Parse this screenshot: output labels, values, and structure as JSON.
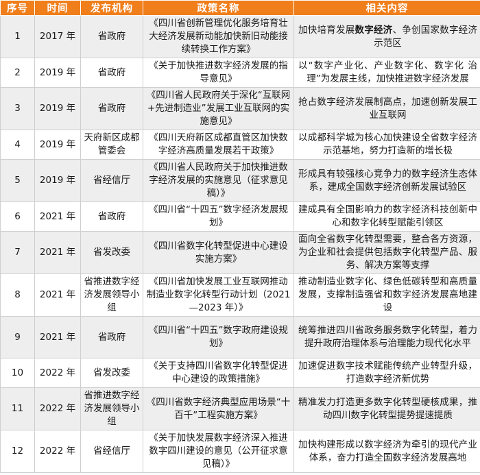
{
  "headers": [
    "序号",
    "时间",
    "发布机构",
    "政策名称",
    "相关内容"
  ],
  "rows": [
    {
      "idx": "1",
      "year": "2017 年",
      "org": "省政府",
      "name": "《四川省创新管理优化服务培育壮大经济发展新动能加快新旧动能接续转换工作方案》",
      "content_pre": "加快培育发展",
      "content_bold": "数字经济",
      "content_post": "、争创国家数字经济示范区"
    },
    {
      "idx": "2",
      "year": "2019 年",
      "org": "省政府",
      "name": "《关于加快推进数字经济发展的指导意见》",
      "content": "以“数字产业化、产业数字化、数字化 治理”为发展主线，加快推进数字经济发展"
    },
    {
      "idx": "3",
      "year": "2019 年",
      "org": "省政府",
      "name": "《四川省人民政府关于深化“互联网+先进制造业”发展工业互联网的实施意见》",
      "content": "抢占数字经济发展制高点，加速创新发展工业互联网"
    },
    {
      "idx": "4",
      "year": "2019 年",
      "org": "天府新区成都管委会",
      "name": "《四川天府新区成都直管区加快数字经济高质量发展若干政策》",
      "content": "以成都科学城为核心加快建设全省数字经济示范基地，努力打造新的增长极"
    },
    {
      "idx": "5",
      "year": "2019 年",
      "org": "省经信厅",
      "name": "《四川省人民政府关于加快推进数字经济发展的实施意见（征求意见稿）》",
      "content": "形成具有较强核心竞争力的数字经济生态体系，建成全国数字经济创新发展试验区"
    },
    {
      "idx": "6",
      "year": "2021 年",
      "org": "省政府",
      "name": "《四川省“十四五”数字经济发展规划》",
      "content": "建成具有全国影响力的数字经济科技创新中心和数字化转型赋能引领区"
    },
    {
      "idx": "7",
      "year": "2021 年",
      "org": "省发改委",
      "name": "《四川省数字化转型促进中心建设实施方案》",
      "content": "面向全省数字化转型需要，整合各方资源，为企业和社会提供包括数字化转型产品、服务、解决方案等支撑"
    },
    {
      "idx": "8",
      "year": "2021 年",
      "org": "省推进数字经济发展领导小组",
      "name": "《四川省加快发展工业互联网推动制造业数字化转型行动计划（2021—2023 年）》",
      "content": "推动制造业数字化、绿色低碳转型和高质量发展，支撑制造强省和数字经济发展高地建设"
    },
    {
      "idx": "9",
      "year": "2021 年",
      "org": "省政府",
      "name": "《四川省“十四五”数字政府建设规划》",
      "content": "统筹推进四川省政务服务数字化转型，着力提升政府治理体系与治理能力现代化水平"
    },
    {
      "idx": "10",
      "year": "2022 年",
      "org": "省发改委",
      "name": "《关于支持四川省数字化转型促进中心建设的政策措施》",
      "content": "加速促进数字技术赋能传统产业转型升级，打造数字经济新优势"
    },
    {
      "idx": "11",
      "year": "2022 年",
      "org": "省推进数字经济发展领导小组",
      "name": "《四川省数字经济典型应用场景“十百千”工程实施方案》",
      "content": "精准发力打造更多数字化转型硬核成果，推动四川数字化转型提势提速提质"
    },
    {
      "idx": "12",
      "year": "2022 年",
      "org": "省经信厅",
      "name": "《关于加快发展数字经济深入推进数字四川建设的意见（公开征求意见稿）》",
      "content": "加快构建形成以数字经济为牵引的现代产业体系，奋力打造全国数字经济发展高地"
    }
  ]
}
